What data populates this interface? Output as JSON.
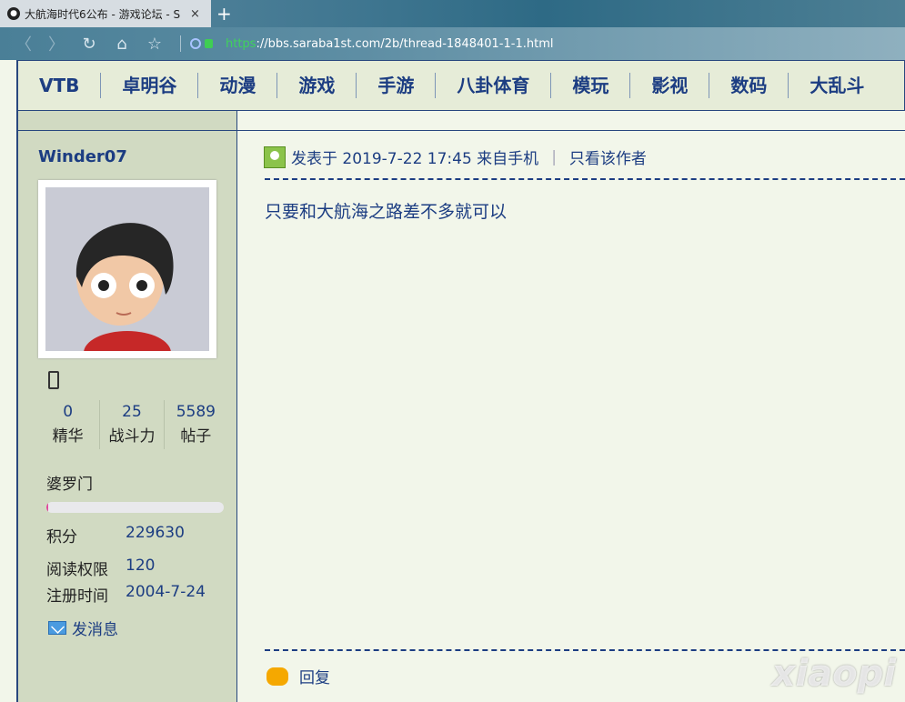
{
  "browser": {
    "tab_title": "大航海时代6公布 - 游戏论坛 - S",
    "tab_close": "×",
    "new_tab": "+",
    "back": "〈",
    "forward": "〉",
    "reload": "↻",
    "home": "⌂",
    "bookmark": "☆",
    "url_protocol": "https",
    "url_rest": "://bbs.saraba1st.com/2b/thread-1848401-1-1.html"
  },
  "nav": {
    "items": [
      "VTB",
      "卓明谷",
      "动漫",
      "游戏",
      "手游",
      "八卦体育",
      "模玩",
      "影视",
      "数码",
      "大乱斗"
    ]
  },
  "user": {
    "name": "Winder07",
    "stats": [
      {
        "value": "0",
        "label": "精华"
      },
      {
        "value": "25",
        "label": "战斗力"
      },
      {
        "value": "5589",
        "label": "帖子"
      }
    ],
    "group": "婆罗门",
    "progress_fraction": 0.01,
    "fields": [
      {
        "key": "积分",
        "value": "229630"
      },
      {
        "key": "阅读权限",
        "value": "120"
      },
      {
        "key": "注册时间",
        "value": "2004-7-24"
      }
    ],
    "message_label": "发消息"
  },
  "post": {
    "meta": "发表于 2019-7-22 17:45 来自手机",
    "author_only": "只看该作者",
    "pipe": "|",
    "content": "只要和大航海之路差不多就可以",
    "reply_label": "回复"
  },
  "watermark": "xiaopi"
}
